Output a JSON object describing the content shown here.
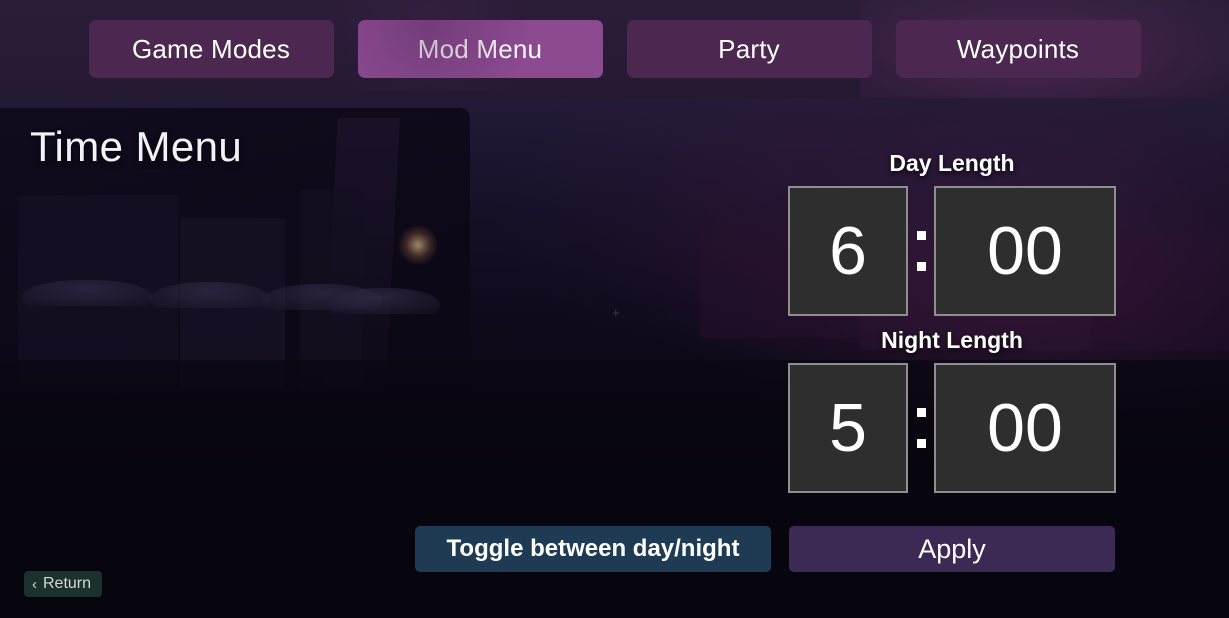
{
  "top_tabs": {
    "items": [
      {
        "label": "Game Modes",
        "active": false
      },
      {
        "label": "Mod Menu",
        "active": true
      },
      {
        "label": "Party",
        "active": false
      },
      {
        "label": "Waypoints",
        "active": false
      }
    ]
  },
  "screen": {
    "title": "Time Menu"
  },
  "day_length": {
    "label": "Day Length",
    "hours": "6",
    "minutes": "00",
    "separator": ":"
  },
  "night_length": {
    "label": "Night Length",
    "hours": "5",
    "minutes": "00",
    "separator": ":"
  },
  "actions": {
    "toggle_label": "Toggle between day/night",
    "apply_label": "Apply"
  },
  "return_button": {
    "label": "Return",
    "icon": "chevron-left-icon",
    "glyph": "‹"
  },
  "colors": {
    "tab_inactive": "#4c2750",
    "tab_active": "#8c4a90",
    "tab_bar_bg": "#281b36",
    "field_bg": "#2e2e2e",
    "field_border": "#8e8e8e",
    "toggle_button": "#1e3b53",
    "apply_button": "#3d2a54",
    "return_button": "#1c302e",
    "text_primary": "#ffffff"
  }
}
